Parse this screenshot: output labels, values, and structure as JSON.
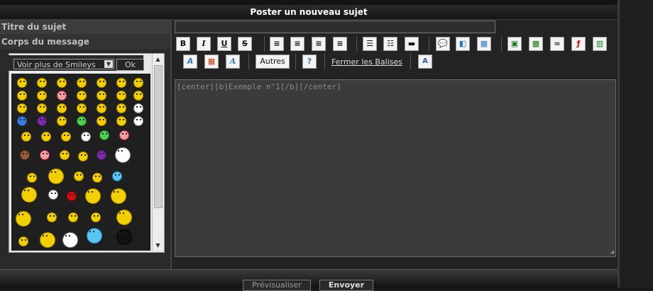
{
  "header": {
    "title": "Poster un nouveau sujet"
  },
  "form": {
    "subject_label": "Titre du sujet",
    "subject_value": "",
    "message_label": "Corps du message"
  },
  "smileys": {
    "select_label": "Voir plus de Smileys",
    "ok_label": "Ok"
  },
  "toolbar": {
    "buttons": [
      "B",
      "I",
      "U",
      "S",
      "align-left",
      "align-center",
      "align-right",
      "align-justify",
      "bullet-list",
      "numbered-list",
      "horizontal-rule",
      "quote",
      "code",
      "table",
      "image-upload",
      "image",
      "link",
      "flash",
      "video",
      "font-color",
      "color-palette",
      "font-size"
    ],
    "autres_label": "Autres",
    "help_label": "?",
    "fermer_label": "Fermer les Balises",
    "clear_label": "A"
  },
  "editor": {
    "content": "[center][b]Exemple n°1[/b][/center]"
  },
  "footer": {
    "preview_label": "Prévisualiser",
    "send_label": "Envoyer"
  }
}
